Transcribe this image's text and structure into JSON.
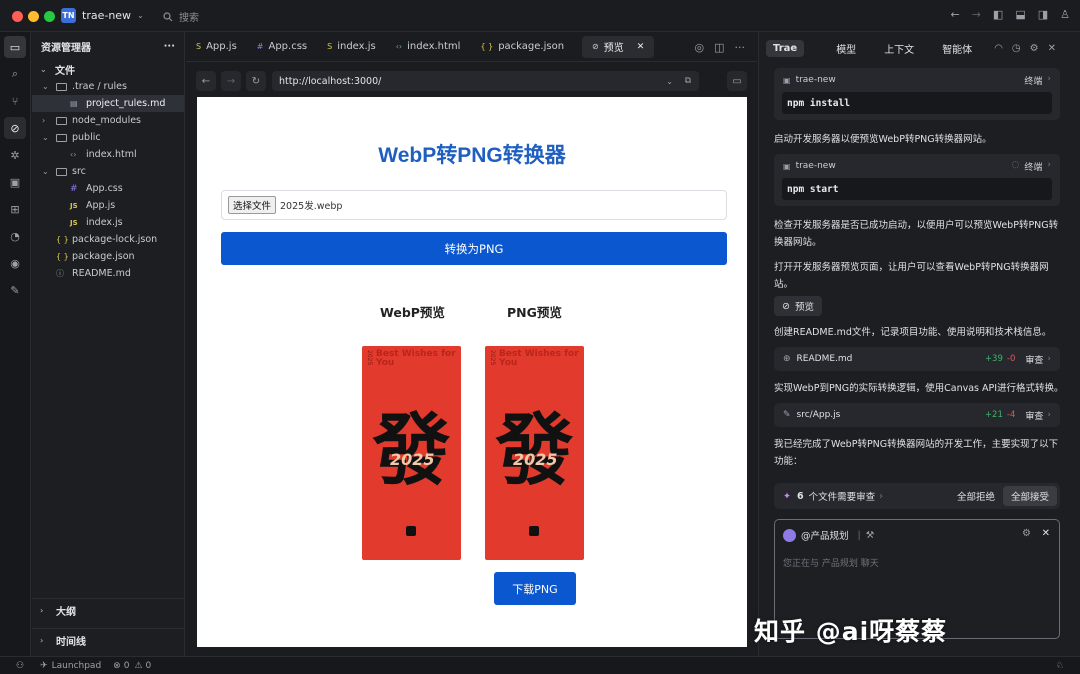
{
  "titlebar": {
    "project_badge": "TN",
    "project": "trae-new",
    "search": "搜索"
  },
  "explorer": {
    "title": "资源管理器",
    "more": "···",
    "files_section": "文件",
    "tree": [
      {
        "label": ".trae / rules",
        "icon": "folder-icon",
        "chev": "⌄"
      },
      {
        "label": "project_rules.md",
        "icon": "md-icon",
        "chev": ""
      },
      {
        "label": "node_modules",
        "icon": "folder-icon",
        "chev": "›"
      },
      {
        "label": "public",
        "icon": "folder-icon",
        "chev": "⌄"
      },
      {
        "label": "index.html",
        "icon": "html-icon",
        "chev": ""
      },
      {
        "label": "src",
        "icon": "folder-icon",
        "chev": "⌄"
      },
      {
        "label": "App.css",
        "icon": "css-icon",
        "chev": ""
      },
      {
        "label": "App.js",
        "icon": "js-icon",
        "chev": ""
      },
      {
        "label": "index.js",
        "icon": "js-icon",
        "chev": ""
      },
      {
        "label": "package-lock.json",
        "icon": "json-icon",
        "chev": ""
      },
      {
        "label": "package.json",
        "icon": "json-icon",
        "chev": ""
      },
      {
        "label": "README.md",
        "icon": "info-icon",
        "chev": ""
      }
    ],
    "outline": "大纲",
    "timeline": "时间线"
  },
  "tabs": [
    {
      "label": "App.js",
      "icon": "js-icon"
    },
    {
      "label": "App.css",
      "icon": "css-icon"
    },
    {
      "label": "index.js",
      "icon": "js-icon"
    },
    {
      "label": "index.html",
      "icon": "html-icon"
    },
    {
      "label": "package.json",
      "icon": "json-icon"
    },
    {
      "label": "预览",
      "icon": "link-icon",
      "active": true
    }
  ],
  "browser": {
    "url": "http://localhost:3000/"
  },
  "app": {
    "title": "WebP转PNG转换器",
    "choose_file": "选择文件",
    "file_name": "2025发.webp",
    "convert_button": "转换为PNG",
    "webp_preview": "WebP预览",
    "png_preview": "PNG预览",
    "poster_year": "2025",
    "poster_heading": "Best Wishes for You",
    "poster_char": "發",
    "poster_script": "2025",
    "download_button": "下载PNG"
  },
  "chat": {
    "tabs": [
      "Trae",
      "模型",
      "上下文",
      "智能体"
    ],
    "card1": {
      "name": "trae-new",
      "label": "终端",
      "cmd": "npm install"
    },
    "text1": "启动开发服务器以便预览WebP转PNG转换器网站。",
    "card2": {
      "name": "trae-new",
      "label": "终端",
      "cmd": "npm start"
    },
    "text2": "检查开发服务器是否已成功启动，以便用户可以预览WebP转PNG转换器网站。",
    "text3": "打开开发服务器预览页面，让用户可以查看WebP转PNG转换器网站。",
    "preview_chip": "预览",
    "text4": "创建README.md文件，记录项目功能、使用说明和技术栈信息。",
    "file1": {
      "name": "README.md",
      "add": "+39",
      "del": "-0",
      "action": "审查"
    },
    "text5": "实现WebP到PNG的实际转换逻辑，使用Canvas API进行格式转换。",
    "file2": {
      "name": "src/App.js",
      "add": "+21",
      "del": "-4",
      "action": "审查"
    },
    "text6": "我已经完成了WebP转PNG转换器网站的开发工作，主要实现了以下功能：",
    "review": {
      "count": "6",
      "label": "个文件需要审查",
      "reject_all": "全部拒绝",
      "accept_all": "全部接受"
    },
    "agent": "@产品规划",
    "input_placeholder": "您正在与 产品规划 聊天"
  },
  "status": {
    "launchpad": "Launchpad",
    "errors": "0",
    "warnings": "0"
  },
  "watermark": "知乎 @ai呀蔡蔡",
  "colors": {
    "accent": "#0b57d0",
    "title_blue": "#1f5fbf",
    "poster_red": "#e23a2c"
  }
}
